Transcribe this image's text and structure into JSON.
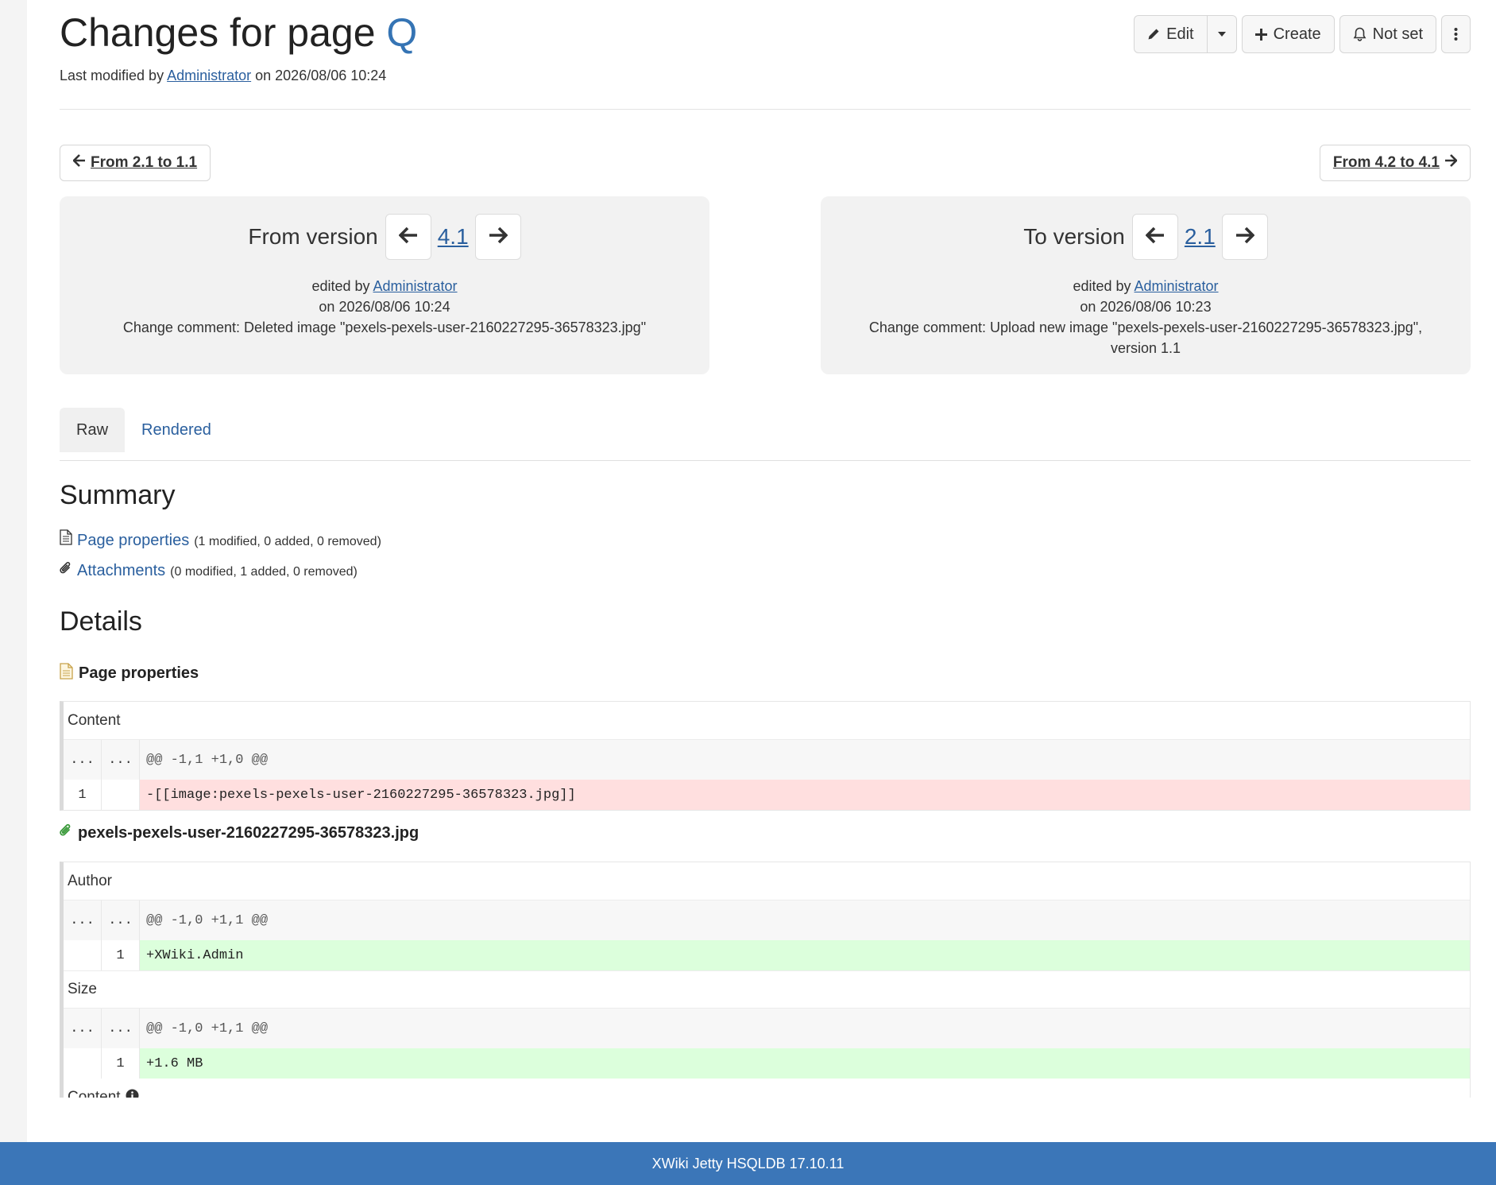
{
  "header": {
    "title_prefix": "Changes for page",
    "page_name": "Q",
    "last_modified_prefix": "Last modified by",
    "author": "Administrator",
    "last_modified_suffix": "on 2026/08/06 10:24"
  },
  "toolbar": {
    "edit_label": "Edit",
    "create_label": "Create",
    "notifications_label": "Not set"
  },
  "pager": {
    "prev_label": "From 2.1 to 1.1",
    "next_label": "From 4.2 to 4.1"
  },
  "from_version": {
    "label": "From version",
    "version": "4.1",
    "edited_by_prefix": "edited by",
    "author": "Administrator",
    "date": "on 2026/08/06 10:24",
    "comment": "Change comment: Deleted image \"pexels-pexels-user-2160227295-36578323.jpg\""
  },
  "to_version": {
    "label": "To version",
    "version": "2.1",
    "edited_by_prefix": "edited by",
    "author": "Administrator",
    "date": "on 2026/08/06 10:23",
    "comment": "Change comment: Upload new image \"pexels-pexels-user-2160227295-36578323.jpg\", version 1.1"
  },
  "tabs": [
    {
      "label": "Raw",
      "active": true
    },
    {
      "label": "Rendered",
      "active": false
    }
  ],
  "summary": {
    "heading": "Summary",
    "items": [
      {
        "label": "Page properties",
        "counts": "(1 modified, 0 added, 0 removed)"
      },
      {
        "label": "Attachments",
        "counts": "(0 modified, 1 added, 0 removed)"
      }
    ]
  },
  "details": {
    "heading": "Details",
    "page_properties": {
      "heading": "Page properties",
      "property": "Content",
      "hunk": {
        "old_ln": "...",
        "new_ln": "...",
        "text": "@@ -1,1 +1,0 @@"
      },
      "line": {
        "old_ln": "1",
        "new_ln": "",
        "text": "-[[image:pexels-pexels-user-2160227295-36578323.jpg]]"
      }
    },
    "attachment": {
      "heading": "pexels-pexels-user-2160227295-36578323.jpg",
      "author": {
        "property": "Author",
        "hunk": {
          "old_ln": "...",
          "new_ln": "...",
          "text": "@@ -1,0 +1,1 @@"
        },
        "line": {
          "old_ln": "",
          "new_ln": "1",
          "text": "+XWiki.Admin"
        }
      },
      "size": {
        "property": "Size",
        "hunk": {
          "old_ln": "...",
          "new_ln": "...",
          "text": "@@ -1,0 +1,1 @@"
        },
        "line": {
          "old_ln": "",
          "new_ln": "1",
          "text": "+1.6 MB"
        }
      },
      "content": {
        "property": "Content"
      }
    }
  },
  "footer": {
    "text": "XWiki Jetty HSQLDB 17.10.11"
  },
  "colors": {
    "accent": "#3574b4",
    "footer": "#3b76b8",
    "deleted": "#ffdfdf",
    "added": "#dcffdc"
  }
}
